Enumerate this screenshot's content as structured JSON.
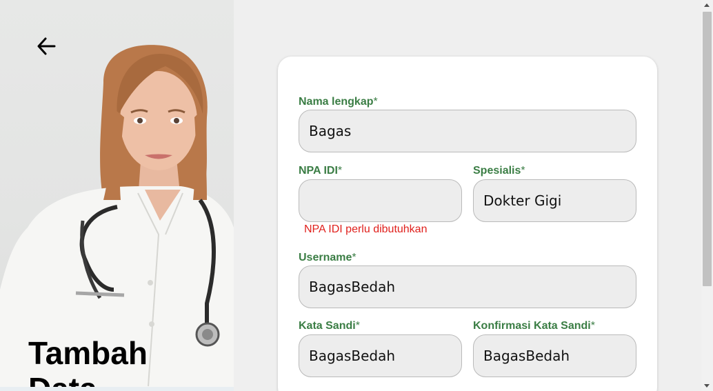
{
  "hero": {
    "title": "Tambah Data",
    "back_icon": "arrow-left-icon"
  },
  "form": {
    "nama": {
      "label": "Nama lengkap",
      "required_mark": "*",
      "value": "Bagas"
    },
    "npa": {
      "label": "NPA IDI",
      "required_mark": "*",
      "value": "",
      "error": "NPA IDI perlu dibutuhkan"
    },
    "spesialis": {
      "label": "Spesialis",
      "required_mark": "*",
      "value": "Dokter Gigi"
    },
    "username": {
      "label": "Username",
      "required_mark": "*",
      "value": "BagasBedah"
    },
    "sandi": {
      "label": "Kata Sandi",
      "required_mark": "*",
      "value": "BagasBedah"
    },
    "konfirmasi": {
      "label": "Konfirmasi Kata Sandi",
      "required_mark": "*",
      "value": "BagasBedah"
    }
  },
  "colors": {
    "label_green": "#3a7d44",
    "error_red": "#e0201c",
    "input_bg": "#ededed"
  }
}
